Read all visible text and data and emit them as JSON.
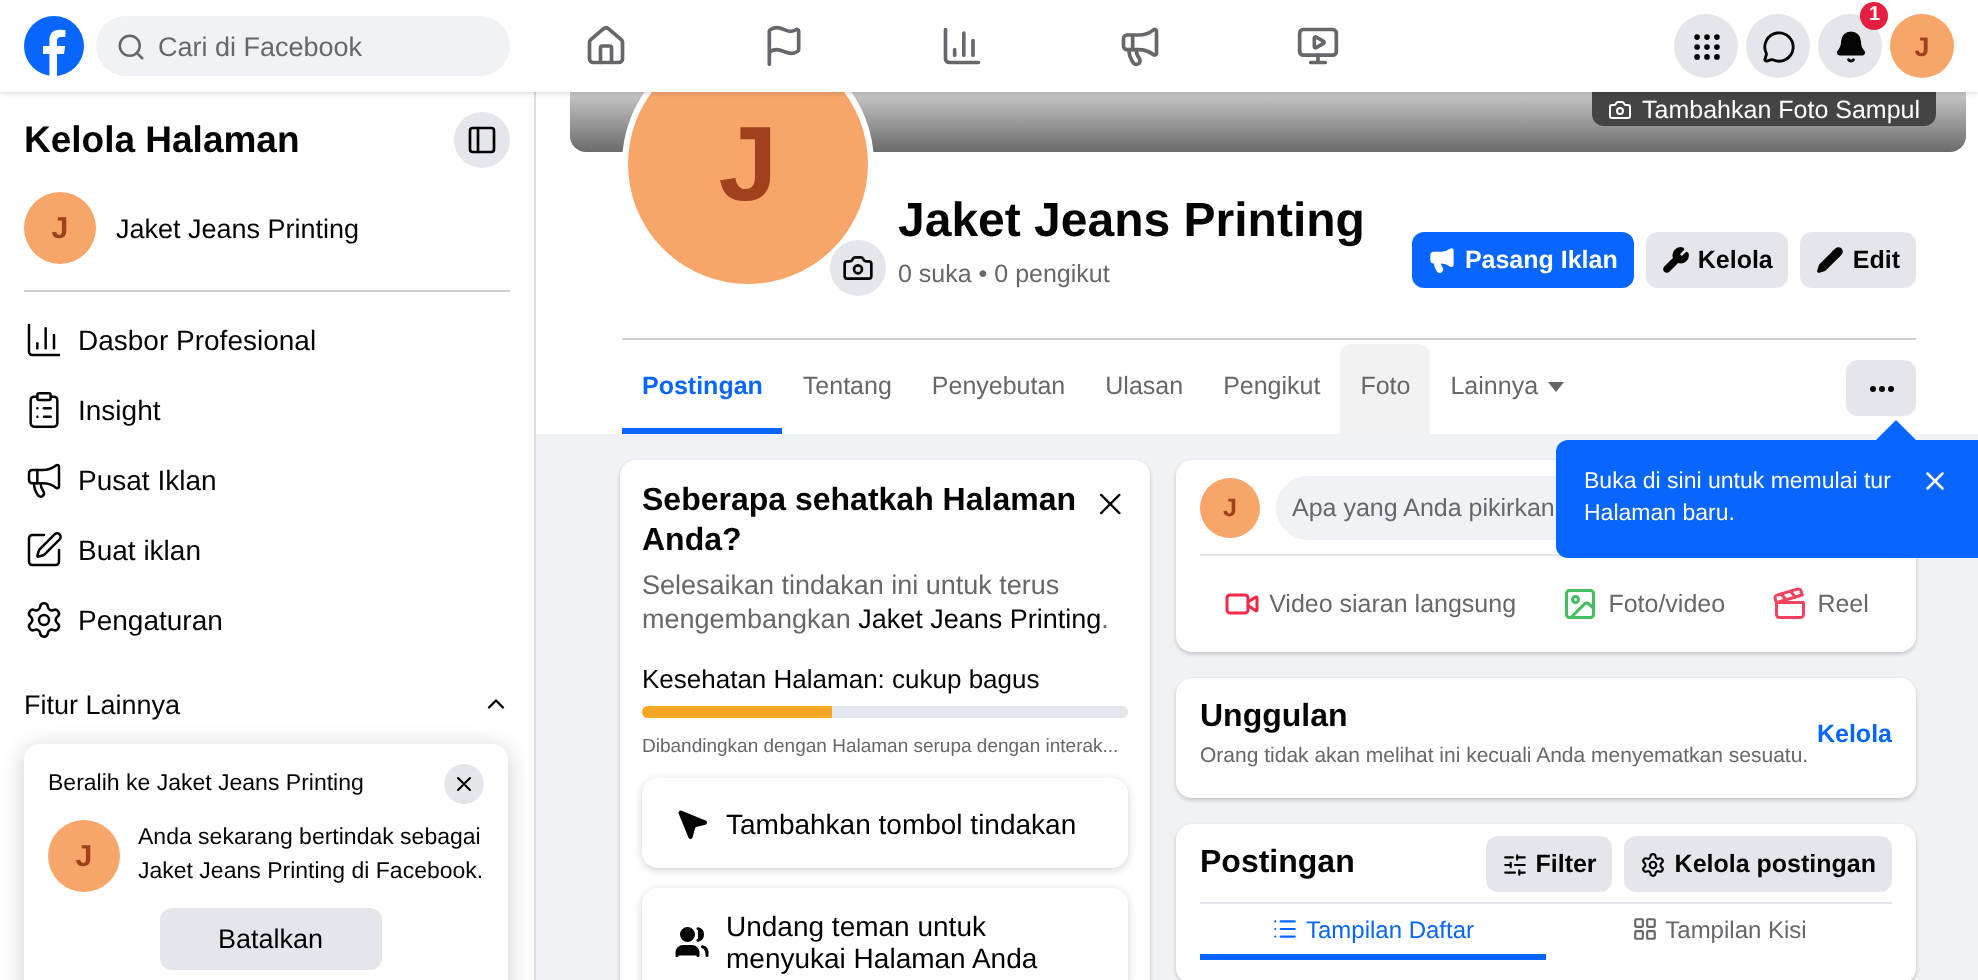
{
  "topbar": {
    "search": {
      "placeholder": "Cari di Facebook"
    },
    "notification_badge": "1",
    "avatar_initial": "J"
  },
  "sidebar": {
    "title": "Kelola Halaman",
    "page": {
      "initial": "J",
      "name": "Jaket Jeans Printing"
    },
    "items": [
      {
        "label": "Dasbor Profesional",
        "kind": "dashboard"
      },
      {
        "label": "Insight",
        "kind": "insight"
      },
      {
        "label": "Pusat Iklan",
        "kind": "ads"
      },
      {
        "label": "Buat iklan",
        "kind": "create"
      },
      {
        "label": "Pengaturan",
        "kind": "settings"
      }
    ],
    "section": {
      "label": "Fitur Lainnya",
      "expanded": true
    }
  },
  "switch_popup": {
    "title": "Beralih ke Jaket Jeans Printing",
    "initial": "J",
    "message": "Anda sekarang bertindak sebagai Jaket Jeans Printing di Facebook.",
    "button": "Batalkan"
  },
  "cover": {
    "button": "Tambahkan Foto Sampul"
  },
  "page": {
    "initial": "J",
    "name": "Jaket Jeans Printing",
    "stats": "0 suka • 0 pengikut",
    "actions": [
      {
        "label": "Pasang Iklan",
        "kind": "primary"
      },
      {
        "label": "Kelola",
        "kind": "manage"
      },
      {
        "label": "Edit",
        "kind": "edit"
      }
    ],
    "tabs": [
      {
        "label": "Postingan",
        "selected": true,
        "hovered": false,
        "dropdown": false
      },
      {
        "label": "Tentang",
        "selected": false,
        "hovered": false,
        "dropdown": false
      },
      {
        "label": "Penyebutan",
        "selected": false,
        "hovered": false,
        "dropdown": false
      },
      {
        "label": "Ulasan",
        "selected": false,
        "hovered": false,
        "dropdown": false
      },
      {
        "label": "Pengikut",
        "selected": false,
        "hovered": false,
        "dropdown": false
      },
      {
        "label": "Foto",
        "selected": false,
        "hovered": true,
        "dropdown": false
      },
      {
        "label": "Lainnya",
        "selected": false,
        "hovered": false,
        "dropdown": true
      }
    ]
  },
  "tour_tooltip": {
    "text": "Buka di sini untuk memulai tur Halaman baru."
  },
  "health_card": {
    "title": "Seberapa sehatkah Halaman Anda?",
    "subtitle": "Selesaikan tindakan ini untuk terus mengembangkan **Jaket Jeans Printing**.",
    "status": "Kesehatan Halaman: cukup bagus",
    "level": 0.39,
    "note": "Dibandingkan dengan Halaman serupa dengan interak...",
    "actions": [
      {
        "label": "Tambahkan tombol tindakan",
        "kind": "cursor"
      },
      {
        "label": "Undang teman untuk menyukai Halaman Anda",
        "kind": "people"
      }
    ]
  },
  "composer": {
    "initial": "J",
    "placeholder": "Apa yang Anda pikirkan",
    "actions": [
      {
        "label": "Video siaran langsung",
        "kind": "live"
      },
      {
        "label": "Foto/video",
        "kind": "photo"
      },
      {
        "label": "Reel",
        "kind": "reel"
      }
    ]
  },
  "featured": {
    "title": "Unggulan",
    "note": "Orang tidak akan melihat ini kecuali Anda menyematkan sesuatu.",
    "link": "Kelola"
  },
  "posts": {
    "title": "Postingan",
    "buttons": [
      {
        "label": "Filter",
        "kind": "filter"
      },
      {
        "label": "Kelola postingan",
        "kind": "settings"
      }
    ],
    "views": [
      {
        "label": "Tampilan Daftar",
        "kind": "list",
        "selected": true
      },
      {
        "label": "Tampilan Kisi",
        "kind": "grid",
        "selected": false
      }
    ]
  }
}
